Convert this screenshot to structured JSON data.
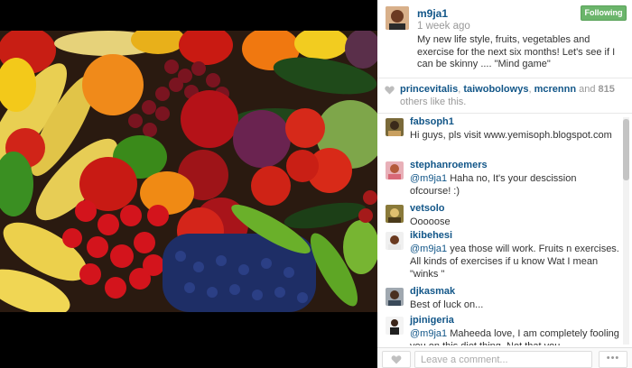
{
  "post": {
    "author": "m9ja1",
    "time": "1 week ago",
    "caption": "My new life style, fruits, vegetables and exercise for the next six months! Let's see if I can be skinny .... \"Mind game\"",
    "follow_label": "Following"
  },
  "likes": {
    "users": [
      "princevitalis",
      "taiwobolowys",
      "mcrennn"
    ],
    "sep1": ", ",
    "sep2": ", ",
    "and_text": " and ",
    "count": "815",
    "suffix": " others like this."
  },
  "comments": [
    {
      "user": "fabsoph1",
      "text": "Hi guys, pls visit www.yemisoph.blogspot.com",
      "mention": ""
    },
    {
      "user": "stephanroemers",
      "mention": "@m9ja1",
      "text": " Haha no, It's your descission ofcourse! :)"
    },
    {
      "user": "vetsolo",
      "mention": "",
      "text": "Ooooose"
    },
    {
      "user": "ikibehesi",
      "mention": "@m9ja1",
      "text": " yea those will work. Fruits n exercises. All kinds of exercises if u know Wat I mean \"winks \""
    },
    {
      "user": "djkasmak",
      "mention": "",
      "text": "Best of luck on..."
    },
    {
      "user": "jpinigeria",
      "mention": "@m9ja1",
      "text": " Maheeda love, I am completely fooling you on this diet thing. Not that you"
    }
  ],
  "footer": {
    "input_placeholder": "Leave a comment...",
    "more_label": "•••"
  },
  "colors": {
    "link": "#125688",
    "follow_green": "#6bb56b"
  }
}
